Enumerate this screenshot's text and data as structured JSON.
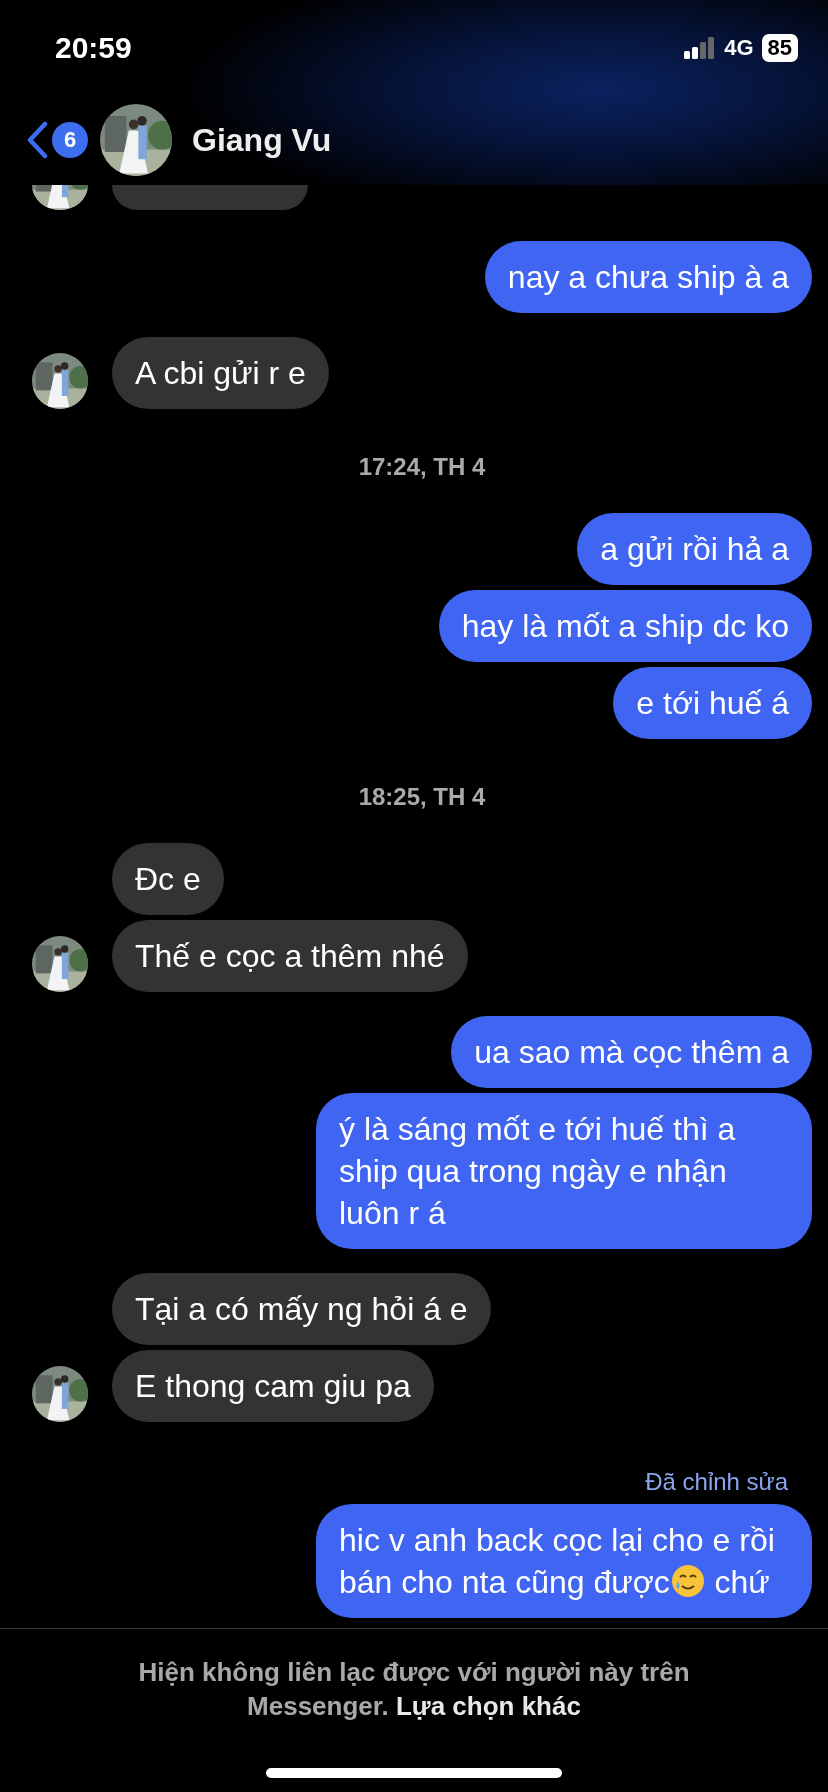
{
  "status_bar": {
    "time": "20:59",
    "network": "4G",
    "battery": "85"
  },
  "header": {
    "unread_count": "6",
    "contact_name": "Giang Vu"
  },
  "messages": [
    {
      "kind": "incoming",
      "avatar": true,
      "cut": true
    },
    {
      "kind": "outgoing",
      "text": "nay a chưa ship à a"
    },
    {
      "kind": "incoming",
      "text": "A cbi gửi r e",
      "avatar": true
    },
    {
      "kind": "timestamp",
      "text": "17:24, TH 4"
    },
    {
      "kind": "outgoing",
      "text": "a gửi rồi hả a"
    },
    {
      "kind": "outgoing",
      "text": "hay là mốt a ship dc ko"
    },
    {
      "kind": "outgoing",
      "text": "e tới huế á"
    },
    {
      "kind": "timestamp",
      "text": "18:25, TH 4"
    },
    {
      "kind": "incoming",
      "text": "Đc e",
      "avatar": false
    },
    {
      "kind": "incoming",
      "text": "Thế e cọc a thêm nhé",
      "avatar": true
    },
    {
      "kind": "outgoing",
      "text": "ua sao mà cọc thêm a"
    },
    {
      "kind": "outgoing",
      "text": "ý là sáng mốt e tới huế thì a ship qua trong ngày e nhận luôn r á"
    },
    {
      "kind": "incoming",
      "text": "Tại a có mấy ng hỏi á e",
      "avatar": false
    },
    {
      "kind": "incoming",
      "text": "E thong cam giu pa",
      "avatar": true
    },
    {
      "kind": "edited",
      "text": "Đã chỉnh sửa"
    },
    {
      "kind": "outgoing",
      "text": "hic v anh back cọc lại cho e rồi bán cho nta cũng được",
      "emoji": true,
      "text_after": " chứ"
    }
  ],
  "footer": {
    "notice": "Hiện không liên lạc được với người này trên Messenger.",
    "link": "Lựa chọn khác"
  }
}
